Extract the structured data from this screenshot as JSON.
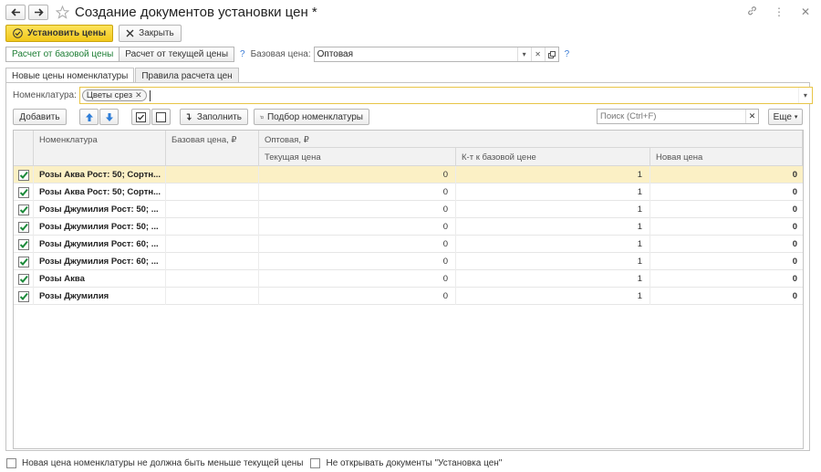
{
  "window": {
    "title": "Создание документов установки цен *",
    "controls": [
      "link-icon",
      "more-icon",
      "close-icon"
    ]
  },
  "toolbar": {
    "apply_label": "Установить цены",
    "close_label": "Закрыть"
  },
  "calc": {
    "from_base": "Расчет от базовой цены",
    "from_current": "Расчет от текущей цены",
    "help": "?",
    "base_price_label": "Базовая цена:",
    "base_price_value": "Оптовая"
  },
  "tabs": [
    {
      "label": "Новые цены номенклатуры"
    },
    {
      "label": "Правила расчета цен"
    }
  ],
  "filter": {
    "label": "Номенклатура:",
    "chip": "Цветы срез"
  },
  "actions": {
    "add_label": "Добавить",
    "fill_label": "Заполнить",
    "pick_label": "Подбор номенклатуры",
    "search_placeholder": "Поиск (Ctrl+F)",
    "more_label": "Еще"
  },
  "table": {
    "headers": {
      "nomenclature": "Номенклатура",
      "base_price": "Базовая цена, ₽",
      "group": "Оптовая, ₽",
      "current_price": "Текущая цена",
      "coef": "К-т к базовой цене",
      "new_price": "Новая цена"
    },
    "rows": [
      {
        "checked": true,
        "name": "Розы Аква Рост: 50; Сортн...",
        "current": "0",
        "coef": "1",
        "new": "0"
      },
      {
        "checked": true,
        "name": "Розы Аква Рост: 50; Сортн...",
        "current": "0",
        "coef": "1",
        "new": "0"
      },
      {
        "checked": true,
        "name": "Розы Джумилия Рост: 50; ...",
        "current": "0",
        "coef": "1",
        "new": "0"
      },
      {
        "checked": true,
        "name": "Розы Джумилия Рост: 50; ...",
        "current": "0",
        "coef": "1",
        "new": "0"
      },
      {
        "checked": true,
        "name": "Розы Джумилия Рост: 60; ...",
        "current": "0",
        "coef": "1",
        "new": "0"
      },
      {
        "checked": true,
        "name": "Розы Джумилия Рост: 60; ...",
        "current": "0",
        "coef": "1",
        "new": "0"
      },
      {
        "checked": true,
        "name": "Розы Аква",
        "current": "0",
        "coef": "1",
        "new": "0"
      },
      {
        "checked": true,
        "name": "Розы Джумилия",
        "current": "0",
        "coef": "1",
        "new": "0"
      }
    ]
  },
  "footer": {
    "opt1": "Новая цена номенклатуры не должна быть меньше текущей цены",
    "opt2": "Не открывать документы \"Установка цен\""
  },
  "colors": {
    "accent_yellow": "#f2c81c",
    "selected_row": "#fbf0c5",
    "check_green": "#1c8a3a",
    "active_text": "#1c7d33"
  }
}
